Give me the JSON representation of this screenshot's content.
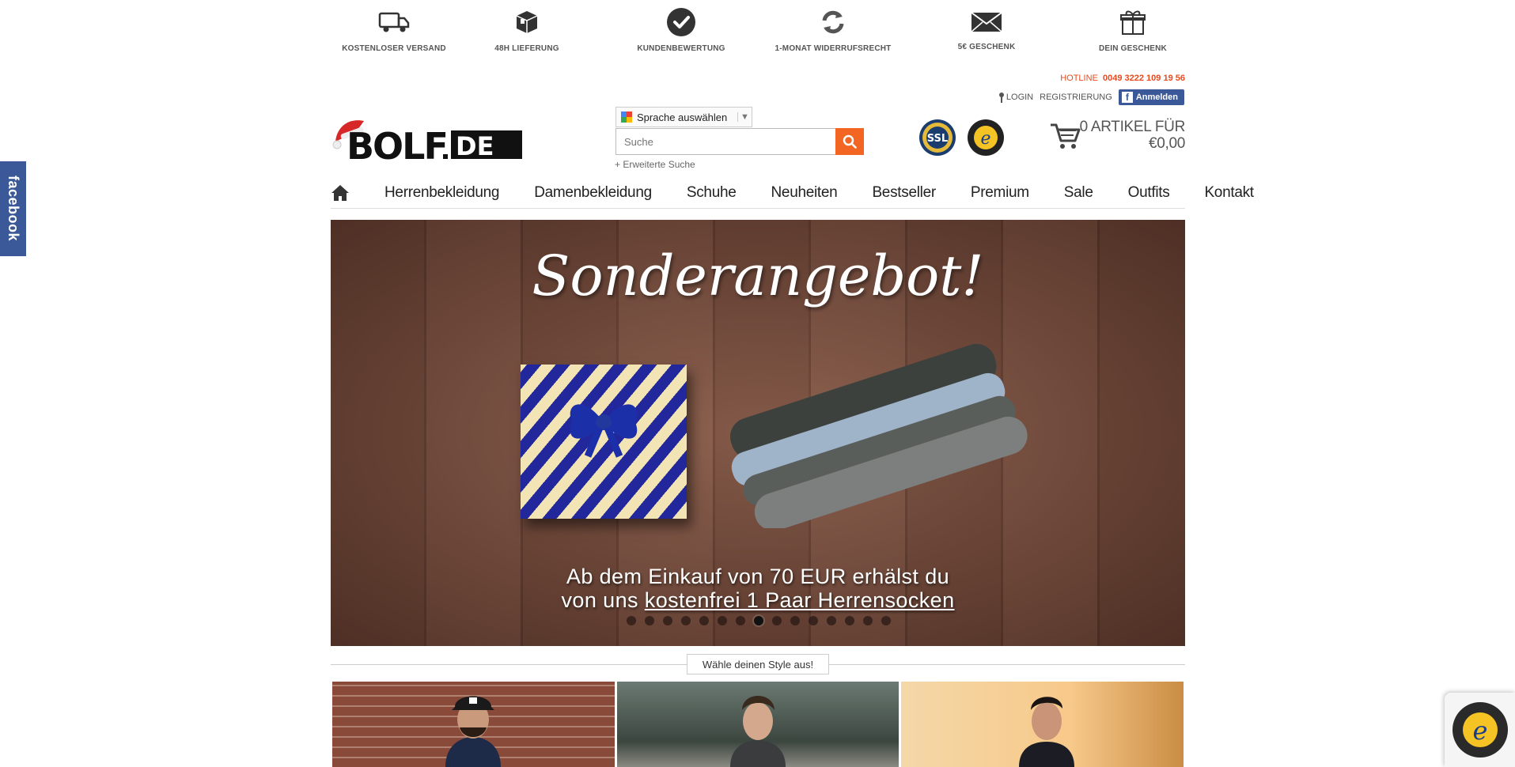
{
  "benefits": [
    {
      "label": "KOSTENLOSER VERSAND",
      "icon": "truck-icon"
    },
    {
      "label": "48H LIEFERUNG",
      "icon": "box-icon"
    },
    {
      "label": "KUNDENBEWERTUNG",
      "icon": "check-icon"
    },
    {
      "label": "1-MONAT WIDERRUFSRECHT",
      "icon": "refresh-icon"
    },
    {
      "label": "5€ GESCHENK",
      "icon": "envelope-icon"
    },
    {
      "label": "DEIN GESCHENK",
      "icon": "gift-icon"
    }
  ],
  "header": {
    "hotline_label": "HOTLINE",
    "hotline_number": "0049 3222 109 19 56",
    "login": "LOGIN",
    "register": "REGISTRIERUNG",
    "fb_login": "Anmelden",
    "logo_text": "BOLF.DE",
    "language_select": "Sprache auswählen",
    "search_placeholder": "Suche",
    "advanced_search": "+ Erweiterte Suche",
    "ssl_badge": "SSL",
    "cart_line1": "0 ARTIKEL FÜR",
    "cart_line2": "€0,00"
  },
  "nav": {
    "items": [
      "Herrenbekleidung",
      "Damenbekleidung",
      "Schuhe",
      "Neuheiten",
      "Bestseller",
      "Premium",
      "Sale",
      "Outfits",
      "Kontakt"
    ]
  },
  "hero": {
    "title": "Sonderangebot!",
    "caption_line1": "Ab dem Einkauf von 70 EUR erhälst du",
    "caption_line2_prefix": "von uns ",
    "caption_line2_link": "kostenfrei 1 Paar Herrensocken",
    "slide_count": 15,
    "active_slide": 7
  },
  "style_section": {
    "label": "Wähle deinen Style aus!"
  },
  "side": {
    "facebook_tab": "facebook"
  },
  "colors": {
    "accent": "#f26522",
    "facebook": "#3b5998",
    "hotline": "#e8491d"
  }
}
